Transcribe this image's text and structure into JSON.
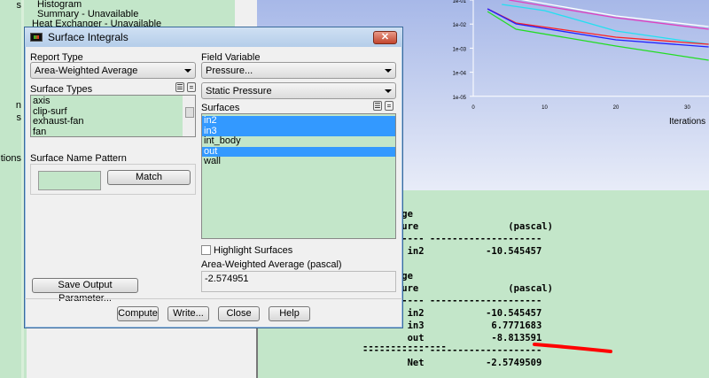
{
  "background": {
    "left_fragments": [
      "s",
      "n",
      "s",
      "tions"
    ],
    "tree_items": [
      "Histogram",
      "Summary - Unavailable",
      "Heat Exchanger - Unavailable"
    ]
  },
  "chart_data": {
    "type": "line",
    "title": "",
    "xlabel": "Iterations",
    "ylabel": "",
    "yscale": "log",
    "ylim": [
      1e-05,
      0.1
    ],
    "xlim": [
      0,
      33
    ],
    "y_ticks": [
      "1e-01",
      "1e-02",
      "1e-03",
      "1e-04",
      "1e-05"
    ],
    "x_ticks": [
      "0",
      "10",
      "20",
      "30"
    ],
    "series": [
      {
        "name": "magenta",
        "color": "#e040c0"
      },
      {
        "name": "white",
        "color": "#ffffff"
      },
      {
        "name": "cyan",
        "color": "#22e0f0"
      },
      {
        "name": "red",
        "color": "#ff2020"
      },
      {
        "name": "blue",
        "color": "#2020ff"
      },
      {
        "name": "green",
        "color": "#22dd22"
      }
    ]
  },
  "dialog": {
    "title": "Surface Integrals",
    "close": "✕",
    "report_type_label": "Report Type",
    "report_type": "Area-Weighted Average",
    "surface_types_label": "Surface Types",
    "surface_types": [
      "axis",
      "clip-surf",
      "exhaust-fan",
      "fan"
    ],
    "field_variable_label": "Field Variable",
    "field_variable": "Pressure...",
    "field_sub": "Static Pressure",
    "surfaces_label": "Surfaces",
    "surfaces": [
      {
        "name": "in2",
        "selected": true
      },
      {
        "name": "in3",
        "selected": true
      },
      {
        "name": "int_body",
        "selected": false
      },
      {
        "name": "out",
        "selected": true
      },
      {
        "name": "wall",
        "selected": false
      }
    ],
    "pattern_label": "Surface Name Pattern",
    "pattern_value": "",
    "match": "Match",
    "highlight": "Highlight Surfaces",
    "result_label": "Area-Weighted Average (pascal)",
    "result_value": "-2.574951",
    "save_param": "Save Output Parameter...",
    "buttons": [
      "Compute",
      "Write...",
      "Close",
      "Help"
    ]
  },
  "console": {
    "text": "d Average\n: Pressure                (pascal)\n----------- --------------------\n        in2           -10.545457\n\nd Average\n: Pressure                (pascal)\n----------- --------------------\n        in2           -10.545457\n        in3            6.7771683\n        out            -8.813591\n----------- --------------------\n        Net           -2.5749509",
    "left_dashes": "---------------"
  }
}
